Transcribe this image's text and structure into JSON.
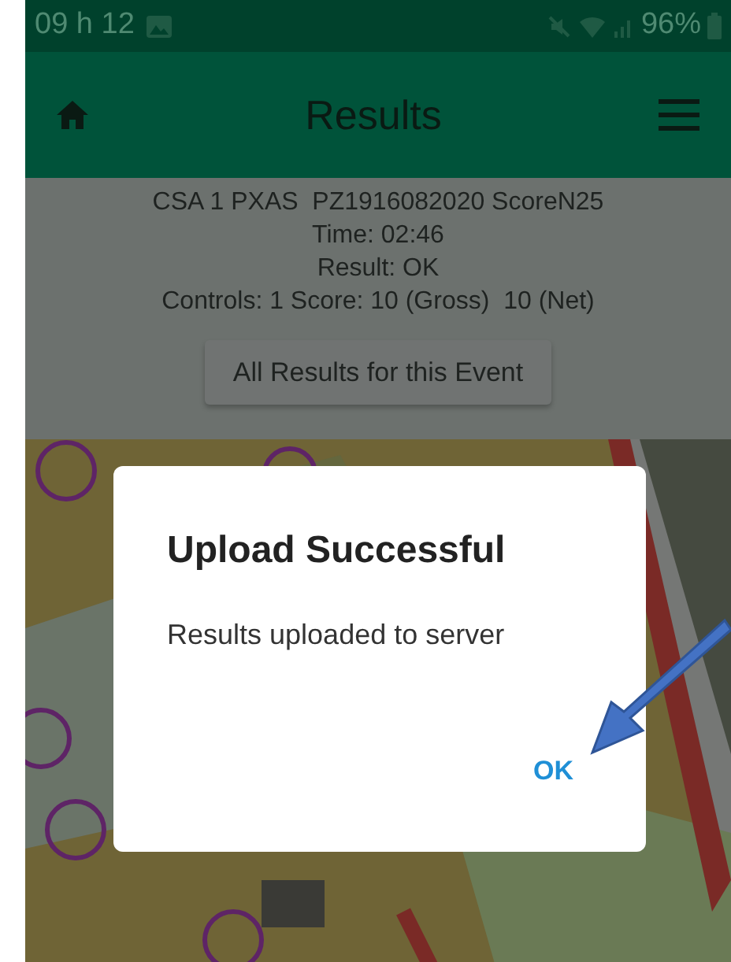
{
  "status_bar": {
    "time": "09 h 12",
    "battery": "96%"
  },
  "app_bar": {
    "title": "Results"
  },
  "result": {
    "lines": [
      "CSA 1 PXAS  PZ1916082020 ScoreN25",
      "Time: 02:46",
      "Result: OK",
      "Controls: 1 Score: 10 (Gross)  10 (Net)"
    ],
    "button": "All Results for this Event"
  },
  "dialog": {
    "title": "Upload Successful",
    "message": "Results uploaded to server",
    "button": "OK"
  }
}
